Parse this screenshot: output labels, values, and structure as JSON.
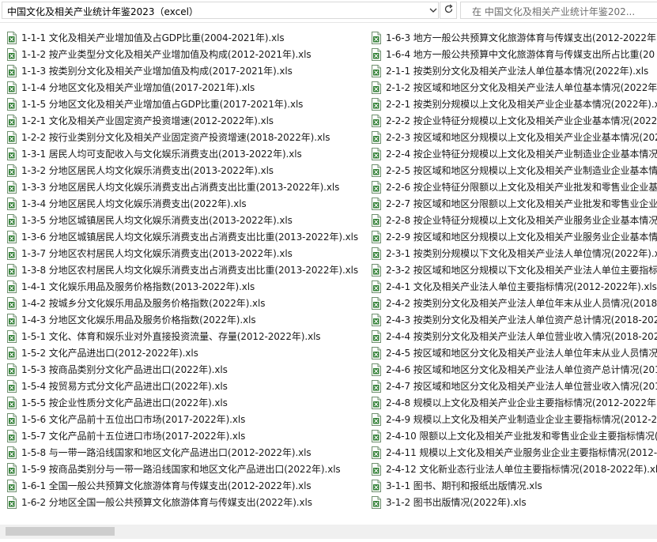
{
  "address": {
    "path": "中国文化及相关产业统计年鉴2023（excel）",
    "search_placeholder": "在 中国文化及相关产业统计年鉴202..."
  },
  "icons": {
    "file": "excel-file-icon",
    "dropdown": "chevron-down-icon",
    "refresh": "refresh-icon",
    "scroll_left": "chevron-left-icon"
  },
  "colors": {
    "excel_green": "#2e7d32",
    "scroll_thumb": "#cdcdcd"
  },
  "files": {
    "column1": [
      "1-1-1 文化及相关产业增加值及占GDP比重(2004-2021年).xls",
      "1-1-2 按产业类型分文化及相关产业增加值及构成(2012-2021年).xls",
      "1-1-3 按类别分文化及相关产业增加值及构成(2017-2021年).xls",
      "1-1-4 分地区文化及相关产业增加值(2017-2021年).xls",
      "1-1-5 分地区文化及相关产业增加值占GDP比重(2017-2021年).xls",
      "1-2-1 文化及相关产业固定资产投资增速(2012-2022年).xls",
      "1-2-2 按行业类别分文化及相关产业固定资产投资增速(2018-2022年).xls",
      "1-3-1 居民人均可支配收入与文化娱乐消费支出(2013-2022年).xls",
      "1-3-2 分地区居民人均文化娱乐消费支出(2013-2022年).xls",
      "1-3-3 分地区居民人均文化娱乐消费支出占消费支出比重(2013-2022年).xls",
      "1-3-4 分地区居民人均文化娱乐消费支出(2022年).xls",
      "1-3-5 分地区城镇居民人均文化娱乐消费支出(2013-2022年).xls",
      "1-3-6 分地区城镇居民人均文化娱乐消费支出占消费支出比重(2013-2022年).xls",
      "1-3-7 分地区农村居民人均文化娱乐消费支出(2013-2022年).xls",
      "1-3-8 分地区农村居民人均文化娱乐消费支出占消费支出比重(2013-2022年).xls",
      "1-4-1 文化娱乐用品及服务价格指数(2013-2022年).xls",
      "1-4-2 按城乡分文化娱乐用品及服务价格指数(2022年).xls",
      "1-4-3 分地区文化娱乐用品及服务价格指数(2022年).xls",
      "1-5-1 文化、体育和娱乐业对外直接投资流量、存量(2012-2022年).xls",
      "1-5-2 文化产品进出口(2012-2022年).xls",
      "1-5-3 按商品类别分文化产品进出口(2022年).xls",
      "1-5-4 按贸易方式分文化产品进出口(2022年).xls",
      "1-5-5 按企业性质分文化产品进出口(2022年).xls",
      "1-5-6 文化产品前十五位出口市场(2017-2022年).xls",
      "1-5-7 文化产品前十五位进口市场(2017-2022年).xls",
      "1-5-8 与一带一路沿线国家和地区文化产品进出口(2012-2022年).xls",
      "1-5-9 按商品类别分与一带一路沿线国家和地区文化产品进出口(2022年).xls",
      "1-6-1 全国一般公共预算文化旅游体育与传媒支出(2012-2022年).xls",
      "1-6-2 分地区全国一般公共预算文化旅游体育与传媒支出(2022年).xls"
    ],
    "column2": [
      "1-6-3 地方一般公共预算文化旅游体育与传媒支出(2012-2022年)",
      "1-6-4 地方一般公共预算中文化旅游体育与传媒支出所占比重(20",
      "2-1-1 按类别分文化及相关产业法人单位基本情况(2022年).xls",
      "2-1-2 按区域和地区分文化及相关产业法人单位基本情况(2022年",
      "2-2-1 按类别分规模以上文化及相关产业企业基本情况(2022年).x",
      "2-2-2 按企业特征分规模以上文化及相关产业企业基本情况(2022",
      "2-2-3 按区域和地区分规模以上文化及相关产业企业基本情况(202",
      "2-2-4 按企业特征分规模以上文化及相关产业制造业企业基本情况",
      "2-2-5 按区域和地区分规模以上文化及相关产业制造业企业基本情",
      "2-2-6 按企业特征分限额以上文化及相关产业批发和零售业企业基",
      "2-2-7 按区域和地区分限额以上文化及相关产业批发和零售业企业",
      "2-2-8 按企业特征分规模以上文化及相关产业服务业企业基本情况",
      "2-2-9 按区域和地区分规模以上文化及相关产业服务业企业基本情",
      "2-3-1 按类别分规模以下文化及相关产业法人单位情况(2022年).x",
      "2-3-2 按区域和地区分规模以下文化及相关产业法人单位主要指标",
      "2-4-1 文化及相关产业法人单位主要指标情况(2012-2022年).xls",
      "2-4-2 按类别分文化及相关产业法人单位年末从业人员情况(2018",
      "2-4-3 按类别分文化及相关产业法人单位资产总计情况(2018-202",
      "2-4-4 按类别分文化及相关产业法人单位营业收入情况(2018-202",
      "2-4-5 按区域和地区分文化及相关产业法人单位年末从业人员情况",
      "2-4-6 按区域和地区分文化及相关产业法人单位资产总计情况(201",
      "2-4-7 按区域和地区分文化及相关产业法人单位营业收入情况(201",
      "2-4-8 规模以上文化及相关产业企业主要指标情况(2012-2022年",
      "2-4-9 规模以上文化及相关产业制造业企业主要指标情况(2012-20",
      "2-4-10 限额以上文化及相关产业批发和零售业企业主要指标情况(",
      "2-4-11 规模以上文化及相关产业服务业企业主要指标情况(2012-",
      "2-4-12 文化新业态行业法人单位主要指标情况(2018-2022年).xls",
      "3-1-1 图书、期刊和报纸出版情况.xls",
      "3-1-2 图书出版情况(2022年).xls"
    ]
  }
}
